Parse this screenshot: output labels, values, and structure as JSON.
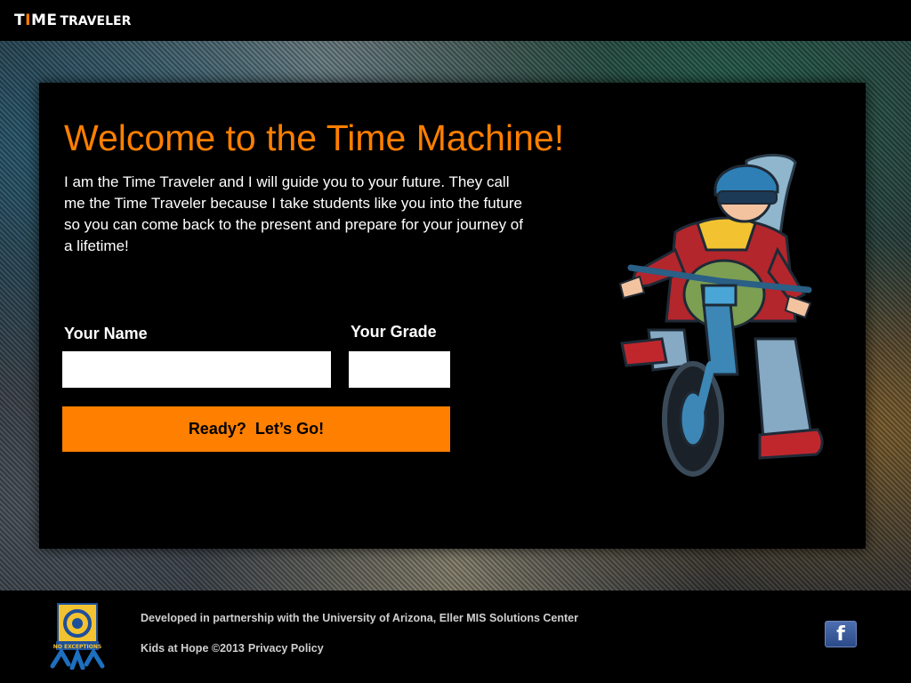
{
  "header": {
    "brand_part1": "T",
    "brand_accent": "I",
    "brand_part2": "ME",
    "brand_part3": "TRAVELER"
  },
  "main": {
    "title": "Welcome to the Time Machine!",
    "intro": "I am the Time Traveler and I will guide you to your future. They call me the Time Traveler because I take students like you into the future so you can come back to the present and prepare for your journey of a lifetime!",
    "name_label": "Your Name",
    "name_value": "",
    "grade_label": "Your Grade",
    "grade_value": "",
    "go_button": "Ready?  Let’s Go!"
  },
  "footer": {
    "line1": "Developed in partnership with the University of Arizona, Eller MIS Solutions Center",
    "copyright": "Kids at Hope ©2013",
    "privacy_link": "Privacy Policy",
    "facebook_icon": "f",
    "logo_text": "NO EXCEPTIONS"
  },
  "colors": {
    "accent": "#ff7f00",
    "panel": "#000000",
    "text": "#ffffff"
  },
  "icons": [
    "facebook-icon",
    "no-exceptions-logo",
    "time-traveler-character"
  ]
}
